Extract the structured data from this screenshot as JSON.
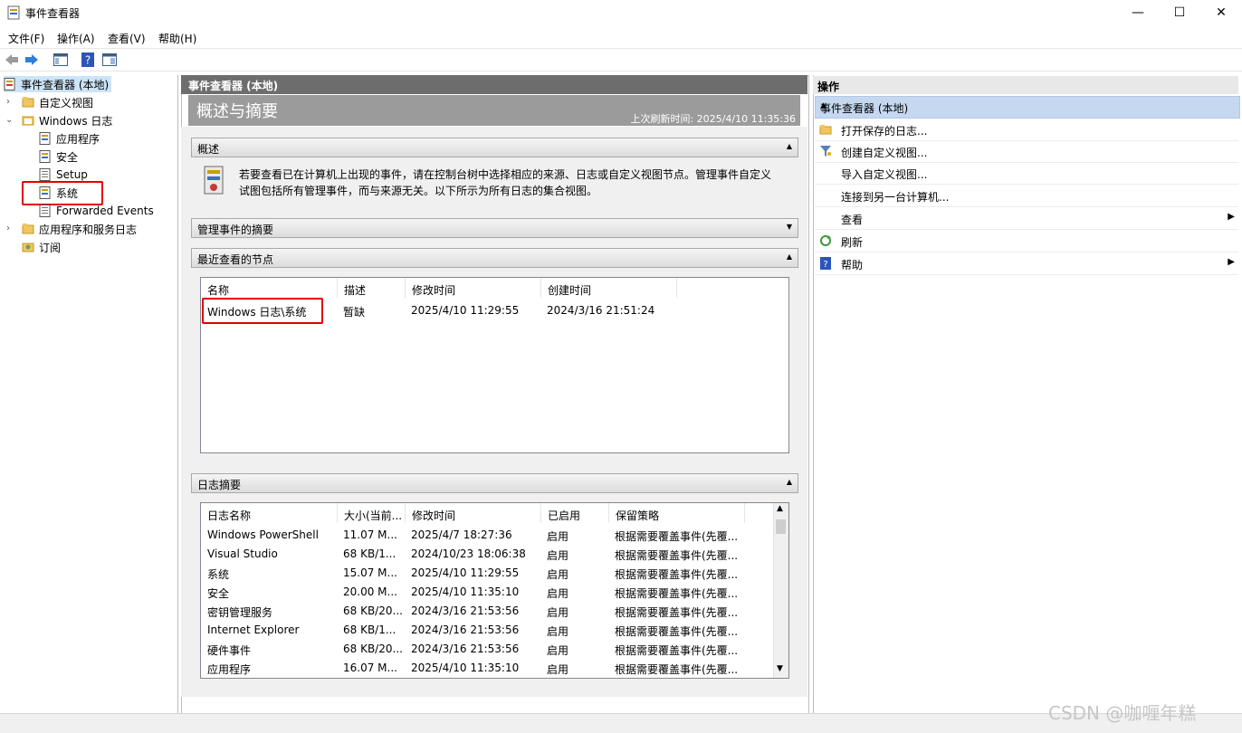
{
  "window": {
    "title": "事件查看器",
    "controls": {
      "minimize": "—",
      "maximize": "☐",
      "close": "✕"
    }
  },
  "menu": {
    "file": "文件(F)",
    "action": "操作(A)",
    "view": "查看(V)",
    "help": "帮助(H)"
  },
  "tree": {
    "root": "事件查看器 (本地)",
    "custom_views": "自定义视图",
    "windows_logs": "Windows 日志",
    "application": "应用程序",
    "security": "安全",
    "setup": "Setup",
    "system": "系统",
    "forwarded": "Forwarded Events",
    "app_services": "应用程序和服务日志",
    "subscriptions": "订阅"
  },
  "center": {
    "header": "事件查看器 (本地)",
    "banner_title": "概述与摘要",
    "last_refresh": "上次刷新时间: 2025/4/10 11:35:36",
    "overview_title": "概述",
    "overview_text_1": "若要查看已在计算机上出现的事件，请在控制台树中选择相应的来源、日志或自定义视图节点。管理事件自定义",
    "overview_text_2": "试图包括所有管理事件，而与来源无关。以下所示为所有日志的集合视图。",
    "admin_summary_title": "管理事件的摘要",
    "recent_title": "最近查看的节点",
    "recent_columns": [
      "名称",
      "描述",
      "修改时间",
      "创建时间"
    ],
    "recent_rows": [
      {
        "name": "Windows 日志\\系统",
        "desc": "暂缺",
        "modified": "2025/4/10 11:29:55",
        "created": "2024/3/16 21:51:24"
      }
    ],
    "log_summary_title": "日志摘要",
    "log_columns": [
      "日志名称",
      "大小(当前...",
      "修改时间",
      "已启用",
      "保留策略"
    ],
    "log_rows": [
      {
        "name": "Windows PowerShell",
        "size": "11.07 M...",
        "modified": "2025/4/7 18:27:36",
        "enabled": "启用",
        "policy": "根据需要覆盖事件(先覆..."
      },
      {
        "name": "Visual Studio",
        "size": "68 KB/1...",
        "modified": "2024/10/23 18:06:38",
        "enabled": "启用",
        "policy": "根据需要覆盖事件(先覆..."
      },
      {
        "name": "系统",
        "size": "15.07 M...",
        "modified": "2025/4/10 11:29:55",
        "enabled": "启用",
        "policy": "根据需要覆盖事件(先覆..."
      },
      {
        "name": "安全",
        "size": "20.00 M...",
        "modified": "2025/4/10 11:35:10",
        "enabled": "启用",
        "policy": "根据需要覆盖事件(先覆..."
      },
      {
        "name": "密钥管理服务",
        "size": "68 KB/20...",
        "modified": "2024/3/16 21:53:56",
        "enabled": "启用",
        "policy": "根据需要覆盖事件(先覆..."
      },
      {
        "name": "Internet Explorer",
        "size": "68 KB/1...",
        "modified": "2024/3/16 21:53:56",
        "enabled": "启用",
        "policy": "根据需要覆盖事件(先覆..."
      },
      {
        "name": "硬件事件",
        "size": "68 KB/20...",
        "modified": "2024/3/16 21:53:56",
        "enabled": "启用",
        "policy": "根据需要覆盖事件(先覆..."
      },
      {
        "name": "应用程序",
        "size": "16.07 M...",
        "modified": "2025/4/10 11:35:10",
        "enabled": "启用",
        "policy": "根据需要覆盖事件(先覆..."
      }
    ]
  },
  "actions": {
    "header": "操作",
    "section": "事件查看器 (本地)",
    "open_saved": "打开保存的日志...",
    "create_view": "创建自定义视图...",
    "import_view": "导入自定义视图...",
    "connect": "连接到另一台计算机...",
    "view": "查看",
    "refresh": "刷新",
    "help": "帮助"
  },
  "watermark": "CSDN @咖喱年糕"
}
